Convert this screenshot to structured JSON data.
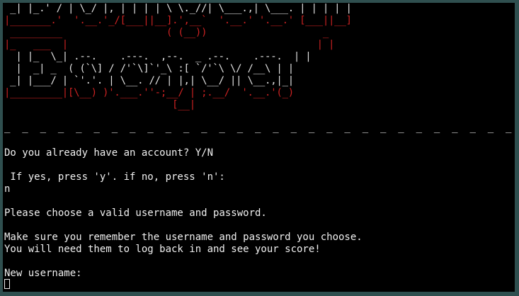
{
  "colors": {
    "background": "#000000",
    "text": "#f0f0f0",
    "art_red": "#cc2222",
    "art_white": "#e0e0e0",
    "frame": "#2f4f4f"
  },
  "banner": {
    "lines": [
      {
        "text": " _| |_.' / | \\_/ |, | | | | \\ \\._//| \\___.,| \\___. | | | | |",
        "color": "white"
      },
      {
        "text": "|_______.'  '.__.'_/[___||__].',__`  '.__.' '.__.' [___||__]",
        "color": "red"
      },
      {
        "text": " _________                  ( (__))                    _",
        "color": "red"
      },
      {
        "text": "|_   ___  |                                           | |",
        "color": "red"
      },
      {
        "text": "  | |_  \\_| .--.    .---.  ,--.  _ .--.    .---.  | |",
        "color": "white"
      },
      {
        "text": "  |  _| _  ( (`\\] / /'`\\]`'_\\ :[ `/'`\\ \\/ /__\\ | |",
        "color": "white"
      },
      {
        "text": " _| |___/ | `'.'. | \\__. // | |,| \\__/ || \\__.,|_|",
        "color": "white"
      },
      {
        "text": "|_________|[\\__) )'.___.''-;__/ | ;.__/  '.__.'(_)",
        "color": "red"
      },
      {
        "text": "                             [__|",
        "color": "red"
      }
    ]
  },
  "terminal": {
    "separator": "_  _  _  _  _  _  _  _  _  _  _  _  _  _  _  _  _  _  _  _  _  _  _  _  _  _  _  _  _  _  _  _  _",
    "lines": [
      "Do you already have an account? Y/N",
      "",
      " If yes, press 'y'. if no, press 'n':",
      "n",
      "",
      "Please choose a valid username and password.",
      "",
      "Make sure you remember the username and password you choose.",
      "You will need them to log back in and see your score!",
      "",
      "New username:"
    ]
  }
}
